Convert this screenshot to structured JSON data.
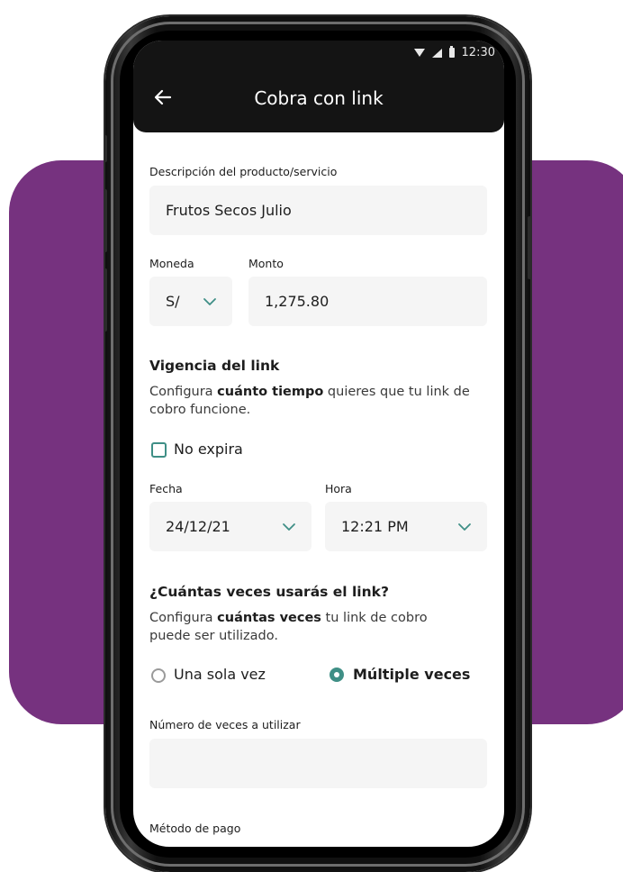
{
  "status_bar": {
    "time": "12:30"
  },
  "app_bar": {
    "title": "Cobra con link"
  },
  "descripcion": {
    "label": "Descripción del producto/servicio",
    "value": "Frutos Secos Julio"
  },
  "moneda": {
    "label": "Moneda",
    "value": "S/"
  },
  "monto": {
    "label": "Monto",
    "value": "1,275.80"
  },
  "vigencia": {
    "title": "Vigencia del link",
    "desc_pre": "Configura ",
    "desc_bold": "cuánto tiempo",
    "desc_post": " quieres que tu link de cobro funcione."
  },
  "no_expira": {
    "label": "No expira",
    "checked": false
  },
  "fecha": {
    "label": "Fecha",
    "value": "24/12/21"
  },
  "hora": {
    "label": "Hora",
    "value": "12:21 PM"
  },
  "usos": {
    "title": "¿Cuántas veces usarás el link?",
    "desc_pre": "Configura ",
    "desc_bold": "cuántas veces",
    "desc_post": " tu link de cobro puede ser utilizado."
  },
  "radio_options": [
    {
      "label": "Una sola vez",
      "selected": false
    },
    {
      "label": "Múltiple veces",
      "selected": true
    }
  ],
  "numero_veces": {
    "label": "Número de veces a utilizar",
    "value": ""
  },
  "metodo_pago": {
    "label": "Método de pago"
  },
  "colors": {
    "accent": "#3f8f86",
    "background_shape": "#76327f",
    "app_bar": "#141414"
  }
}
